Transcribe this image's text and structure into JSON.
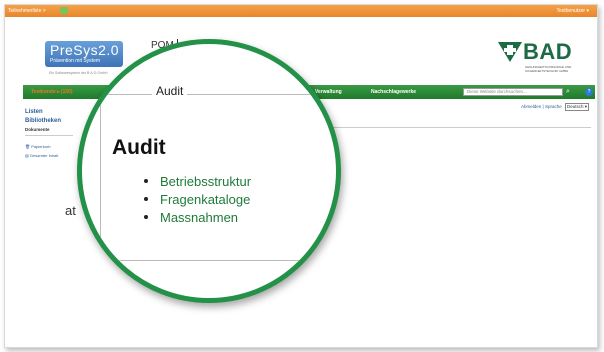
{
  "topbar": {
    "site_link": "Teilnehmerliste >",
    "user_menu": "Testbenutzer ▾"
  },
  "logo": {
    "name": "PreSys2.0",
    "tagline": "Prävention mit System",
    "subtitle": "Ein Softwaresystem der B·A·D GmbH"
  },
  "top_link": "POM",
  "bad_logo": {
    "word": "BAD",
    "subtitle": "GESUNDHEITSVORSORGE UND SICHERHEITSTECHNIK GMBH"
  },
  "navbar": {
    "home": "Testkunde ▸ (150)",
    "items": [
      "Verwaltung",
      "Nachschlagewerke"
    ],
    "search_placeholder": "Diese Website durchsuchen..."
  },
  "utility": {
    "signout": "Abmelden",
    "separator": "|",
    "language_label": "Sprache",
    "language_value": "Deutsch ▾"
  },
  "left_nav": {
    "lists": "Listen",
    "libraries": "Bibliotheken",
    "documents": "Dokumente",
    "recycle": "Papierkorb",
    "all_content": "Gesamter Inhalt",
    "partial_title": "at"
  },
  "magnifier": {
    "web_part_title": "Audit",
    "heading": "Audit",
    "links": [
      "Betriebsstruktur",
      "Fragenkataloge",
      "Massnahmen"
    ]
  },
  "colors": {
    "brand_green": "#239148",
    "topbar_orange": "#e8852a",
    "link_green": "#1e7a3a"
  }
}
